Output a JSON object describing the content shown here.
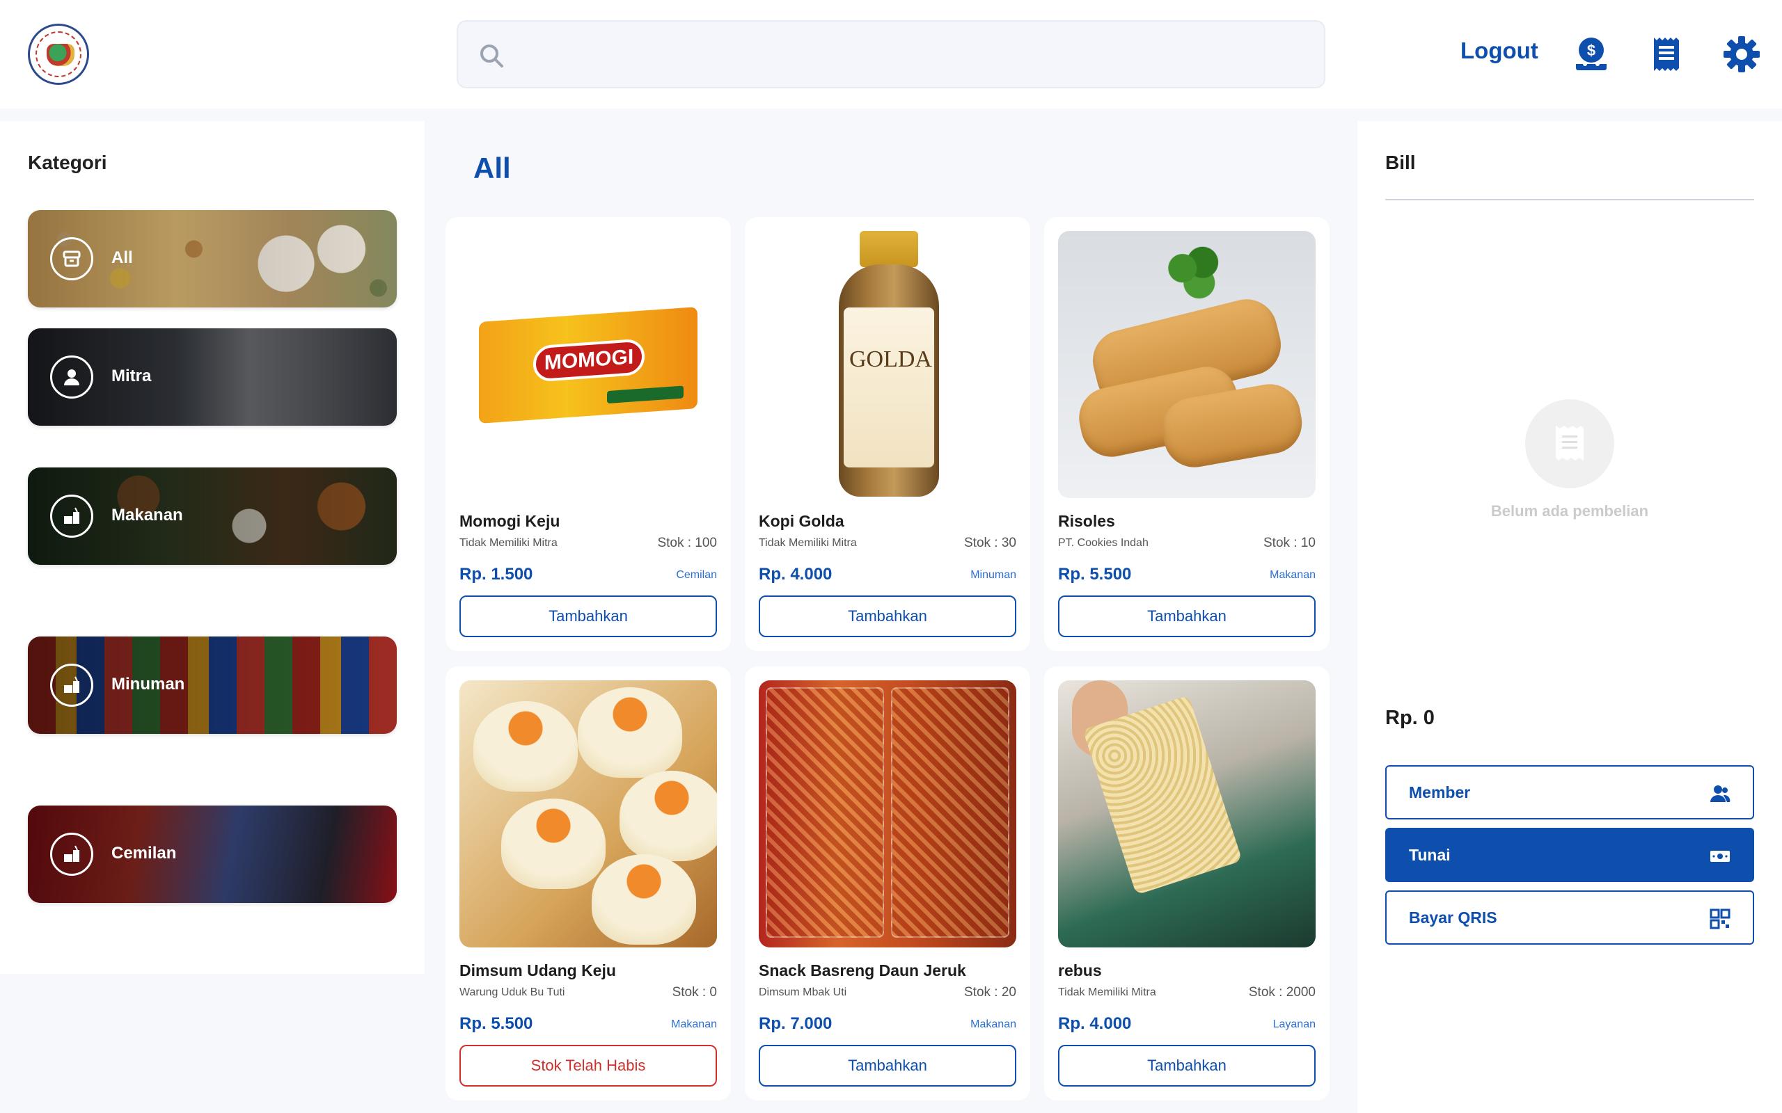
{
  "header": {
    "logo_icon": "cooperative-logo",
    "search_placeholder": "",
    "logout_label": "Logout",
    "icons": [
      "payment-icon",
      "receipt-icon",
      "gear-icon"
    ]
  },
  "sidebar": {
    "title": "Kategori",
    "categories": [
      {
        "label": "All",
        "icon": "box-icon"
      },
      {
        "label": "Mitra",
        "icon": "person-icon"
      },
      {
        "label": "Makanan",
        "icon": "food-icon"
      },
      {
        "label": "Minuman",
        "icon": "food-icon"
      },
      {
        "label": "Cemilan",
        "icon": "food-icon"
      }
    ]
  },
  "main": {
    "title": "All",
    "products": [
      {
        "name": "Momogi Keju",
        "mitra": "Tidak Memiliki Mitra",
        "stok": "Stok : 100",
        "price": "Rp. 1.500",
        "category": "Cemilan",
        "button": "Tambahkan",
        "available": true,
        "image": "momogi-package"
      },
      {
        "name": "Kopi Golda",
        "mitra": "Tidak Memiliki Mitra",
        "stok": "Stok : 30",
        "price": "Rp. 4.000",
        "category": "Minuman",
        "button": "Tambahkan",
        "available": true,
        "image": "golda-bottle",
        "image_text": "GOLDA"
      },
      {
        "name": "Risoles",
        "mitra": "PT. Cookies Indah",
        "stok": "Stok : 10",
        "price": "Rp. 5.500",
        "category": "Makanan",
        "button": "Tambahkan",
        "available": true,
        "image": "risoles-photo"
      },
      {
        "name": "Dimsum Udang Keju",
        "mitra": "Warung Uduk Bu Tuti",
        "stok": "Stok : 0",
        "price": "Rp. 5.500",
        "category": "Makanan",
        "button": "Stok Telah Habis",
        "available": false,
        "image": "dimsum-photo"
      },
      {
        "name": "Snack Basreng Daun Jeruk",
        "mitra": "Dimsum Mbak Uti",
        "stok": "Stok : 20",
        "price": "Rp. 7.000",
        "category": "Makanan",
        "button": "Tambahkan",
        "available": true,
        "image": "basreng-photo"
      },
      {
        "name": "rebus",
        "mitra": "Tidak Memiliki Mitra",
        "stok": "Stok : 2000",
        "price": "Rp. 4.000",
        "category": "Layanan",
        "button": "Tambahkan",
        "available": true,
        "image": "noodle-photo"
      }
    ]
  },
  "bill": {
    "title": "Bill",
    "empty_text": "Belum ada pembelian",
    "total": "Rp. 0",
    "options": [
      {
        "label": "Member",
        "icon": "member-icon",
        "active": false
      },
      {
        "label": "Tunai",
        "icon": "cash-icon",
        "active": true
      },
      {
        "label": "Bayar QRIS",
        "icon": "qr-icon",
        "active": false
      }
    ]
  },
  "colors": {
    "primary": "#0e4fae",
    "danger": "#d0312d",
    "background": "#f6f8fc"
  }
}
